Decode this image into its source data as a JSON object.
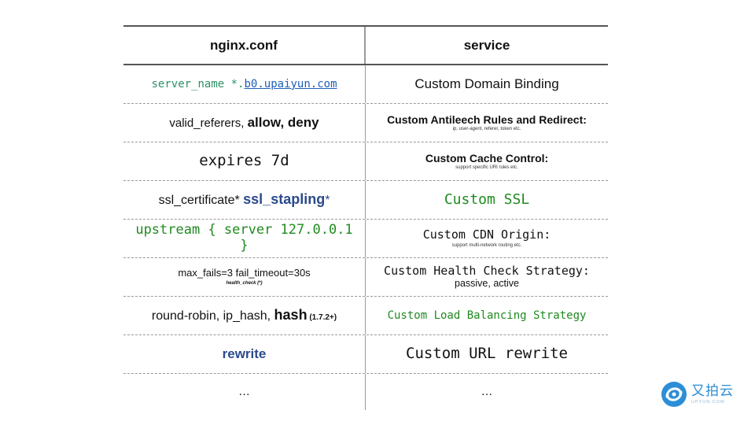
{
  "table": {
    "headers": {
      "left": "nginx.conf",
      "right": "service"
    },
    "rows": [
      {
        "left": {
          "prefix": "server_name *.",
          "link": "b0.upaiyun.com"
        },
        "right": {
          "text": "Custom Domain Binding"
        }
      },
      {
        "left": {
          "text": "valid_referers, ",
          "bold": "allow, deny"
        },
        "right": {
          "text": "Custom Antileech Rules and Redirect:",
          "note": "ip, user-agent, referer, token etc."
        }
      },
      {
        "left": {
          "text": "expires 7d"
        },
        "right": {
          "text": "Custom Cache Control:",
          "note": "support specific URI rules etc."
        }
      },
      {
        "left": {
          "text": "ssl_certificate* ",
          "bold": "ssl_stapling",
          "suffix": "*"
        },
        "right": {
          "text": "Custom SSL"
        }
      },
      {
        "left": {
          "line1": "upstream { server 127.0.0.1",
          "line2": "}"
        },
        "right": {
          "text": "Custom CDN Origin:",
          "note": "support multi-network routing etc."
        }
      },
      {
        "left": {
          "text": "max_fails=3  fail_timeout=30s",
          "note": "health_check (*)"
        },
        "right": {
          "text": "Custom Health Check Strategy:",
          "sub": "passive, active"
        }
      },
      {
        "left": {
          "text": "round-robin, ip_hash, ",
          "bold": "hash",
          "version": " (1.7.2+)"
        },
        "right": {
          "text": "Custom Load Balancing Strategy"
        }
      },
      {
        "left": {
          "text": "rewrite"
        },
        "right": {
          "text": "Custom URL rewrite"
        }
      },
      {
        "left": {
          "text": "…"
        },
        "right": {
          "text": "…"
        }
      }
    ]
  },
  "logo": {
    "cn": "又拍云",
    "en": "UPYUN.COM"
  },
  "colors": {
    "green": "#1f8a1f",
    "teal": "#2e8f66",
    "navy": "#2b4a8c",
    "link": "#1d5fb8",
    "logo_blue": "#2c8ed6"
  }
}
